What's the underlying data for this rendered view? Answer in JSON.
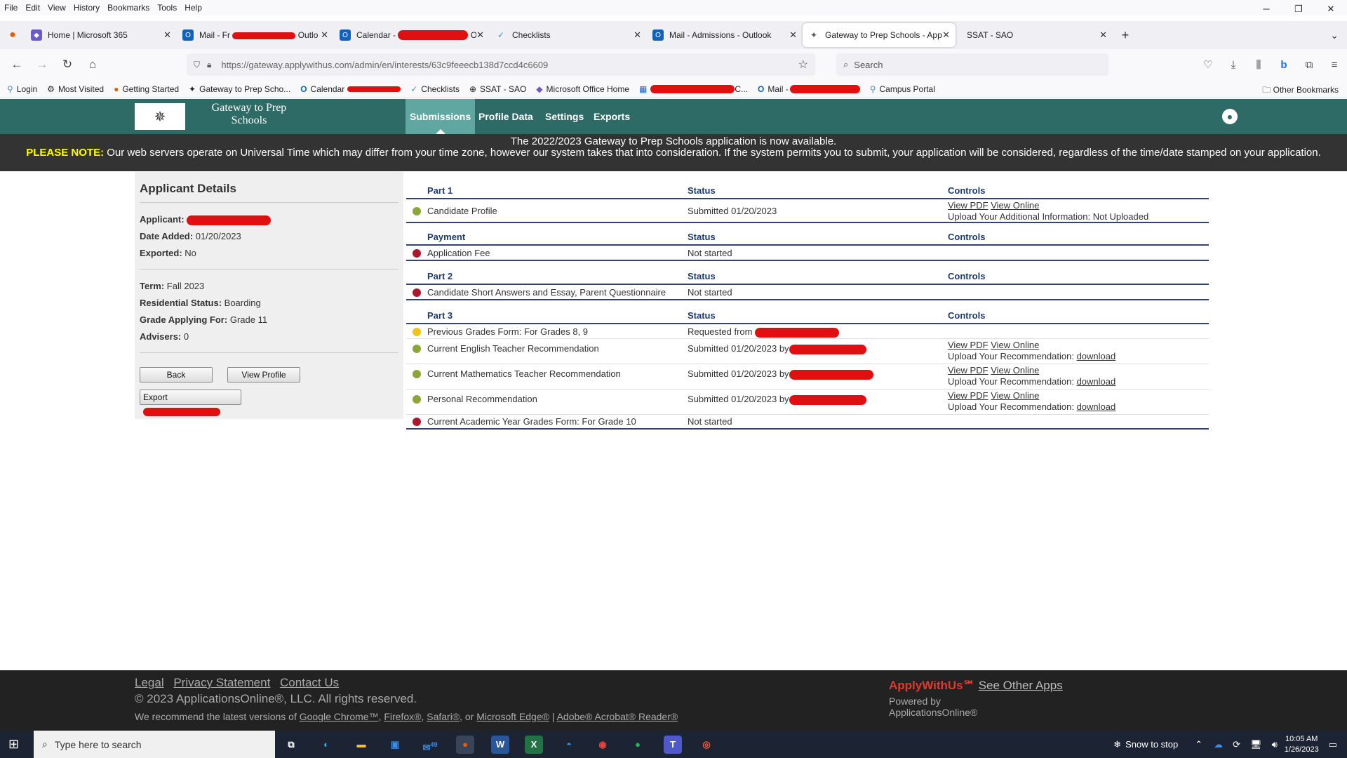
{
  "browser": {
    "menu": [
      "File",
      "Edit",
      "View",
      "History",
      "Bookmarks",
      "Tools",
      "Help"
    ],
    "tabs": [
      {
        "label": "Home | Microsoft 365",
        "icon": "m365-icon"
      },
      {
        "label": "Mail - Fr",
        "icon": "outlook-icon",
        "redacted": true,
        "suffix": "Outlo"
      },
      {
        "label": "Calendar -",
        "icon": "outlook-icon",
        "redacted": true,
        "suffix": "O"
      },
      {
        "label": "Checklists",
        "icon": "checklist-icon"
      },
      {
        "label": "Mail - Admissions - Outlook",
        "icon": "outlook-icon"
      },
      {
        "label": "Gateway to Prep Schools - Appl",
        "icon": "compass-icon",
        "active": true
      },
      {
        "label": "SSAT - SAO",
        "icon": "none"
      }
    ],
    "url": "https://gateway.applywithus.com/admin/en/interests/63c9feeecb138d7ccd4c6609",
    "search_placeholder": "Search",
    "bookmarks": [
      "Login",
      "Most Visited",
      "Getting Started",
      "Gateway to Prep Scho...",
      "Calendar",
      "Checklists",
      "SSAT - SAO",
      "Microsoft Office Home",
      "C...",
      "Mail -",
      "Campus Portal"
    ],
    "other_bookmarks": "Other Bookmarks"
  },
  "site": {
    "logo_text": "Gateway to Prep Schools",
    "nav": [
      "Submissions",
      "Profile Data",
      "Settings",
      "Exports"
    ],
    "notice_line1": "The 2022/2023 Gateway to Prep Schools application is now available.",
    "notice_label": "PLEASE NOTE:",
    "notice_body": "Our web servers operate on Universal Time which may differ from your time zone, however our system takes that into consideration. If the system permits you to submit, your application will be considered, regardless of the time/date stamped on your application."
  },
  "applicant": {
    "heading": "Applicant Details",
    "applicant_label": "Applicant:",
    "date_added_label": "Date Added:",
    "date_added": "01/20/2023",
    "exported_label": "Exported:",
    "exported": "No",
    "term_label": "Term:",
    "term": "Fall 2023",
    "residential_label": "Residential Status:",
    "residential": "Boarding",
    "grade_label": "Grade Applying For:",
    "grade": "Grade 11",
    "advisers_label": "Advisers:",
    "advisers": "0",
    "back_button": "Back",
    "view_profile_button": "View Profile",
    "export_button": "Export"
  },
  "sections": [
    {
      "title": "Part 1",
      "status": "Status",
      "controls": "Controls",
      "rows": [
        {
          "name": "Candidate Profile",
          "status": "Submitted 01/20/2023",
          "dot": "#8aa63a",
          "c_pdf": "View PDF",
          "c_online": "View Online",
          "c_line2": "Upload Your Additional Information: Not Uploaded"
        }
      ]
    },
    {
      "title": "Payment",
      "status": "Status",
      "controls": "Controls",
      "rows": [
        {
          "name": "Application Fee",
          "status": "Not started",
          "dot": "#b0172b"
        }
      ]
    },
    {
      "title": "Part 2",
      "status": "Status",
      "controls": "Controls",
      "rows": [
        {
          "name": "Candidate Short Answers and Essay, Parent Questionnaire",
          "status": "Not started",
          "dot": "#b0172b"
        }
      ]
    },
    {
      "title": "Part 3",
      "status": "Status",
      "controls": "Controls",
      "rows": [
        {
          "name": "Previous Grades Form: For Grades 8, 9",
          "status": "Requested from",
          "dot": "#f0c419"
        },
        {
          "name": "Current English Teacher Recommendation",
          "status": "Submitted 01/20/2023 by",
          "dot": "#8aa63a",
          "c_pdf": "View PDF",
          "c_online": "View Online",
          "c_line2": "Upload Your Recommendation:",
          "c_link": "download"
        },
        {
          "name": "Current Mathematics Teacher Recommendation",
          "status": "Submitted 01/20/2023 by",
          "dot": "#8aa63a",
          "c_pdf": "View PDF",
          "c_online": "View Online",
          "c_line2": "Upload Your Recommendation:",
          "c_link": "download"
        },
        {
          "name": "Personal Recommendation",
          "status": "Submitted 01/20/2023 by",
          "dot": "#8aa63a",
          "c_pdf": "View PDF",
          "c_online": "View Online",
          "c_line2": "Upload Your Recommendation:",
          "c_link": "download"
        },
        {
          "name": "Current Academic Year Grades Form: For Grade 10",
          "status": "Not started",
          "dot": "#b0172b"
        }
      ]
    }
  ],
  "footer": {
    "links": [
      "Legal",
      "Privacy Statement",
      "Contact Us"
    ],
    "copyright": "© 2023 ApplicationsOnline®, LLC. All rights reserved.",
    "recommend_prefix": "We recommend the latest versions of",
    "browsers": [
      "Google Chrome™",
      "Firefox®",
      "Safari®",
      "Microsoft Edge®"
    ],
    "or": "or",
    "acrobat": "Adobe® Acrobat® Reader®",
    "brand": "ApplyWithUs℠",
    "see_other": "See Other Apps",
    "powered1": "Powered by",
    "powered2": "ApplicationsOnline®"
  },
  "taskbar": {
    "search_placeholder": "Type here to search",
    "mail_badge": "49",
    "weather": "Snow to stop",
    "time": "10:05 AM",
    "date": "1/26/2023"
  }
}
